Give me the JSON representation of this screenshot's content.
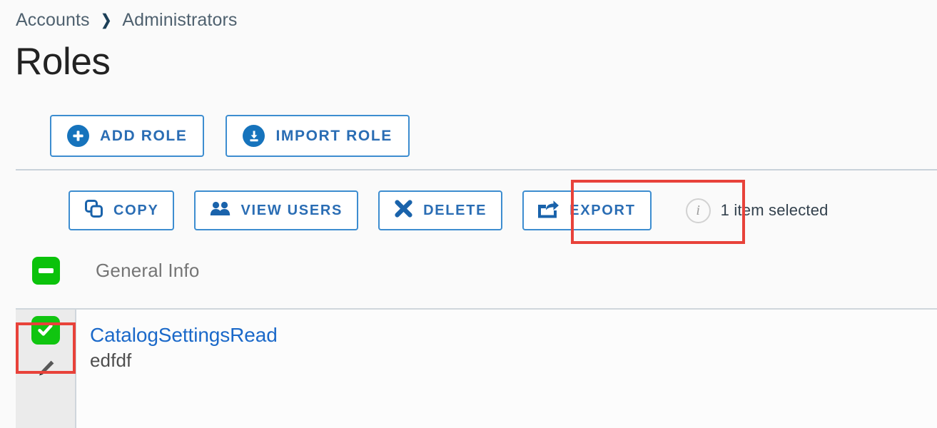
{
  "breadcrumb": {
    "items": [
      {
        "label": "Accounts"
      },
      {
        "label": "Administrators"
      }
    ],
    "separator": "❯"
  },
  "page": {
    "title": "Roles"
  },
  "actions": [
    {
      "label": "Add Role",
      "icon": "plus-circle-icon"
    },
    {
      "label": "Import Role",
      "icon": "import-circle-icon"
    }
  ],
  "toolbar": {
    "buttons": [
      {
        "label": "Copy",
        "icon": "copy-icon"
      },
      {
        "label": "View Users",
        "icon": "users-icon"
      },
      {
        "label": "Delete",
        "icon": "close-x-icon"
      },
      {
        "label": "Export",
        "icon": "export-icon"
      }
    ],
    "info_icon": "info-icon",
    "info_glyph": "i",
    "selection_status": "1 item selected"
  },
  "section": {
    "label": "General Info",
    "collapse_icon": "collapse-minus-icon",
    "expanded": true
  },
  "grid": {
    "rows": [
      {
        "selected": true,
        "checkbox_icon": "checkbox-checked-icon",
        "edit_icon": "pencil-icon",
        "name": "CatalogSettingsRead",
        "description": "edfdf"
      }
    ]
  },
  "annotations": [
    {
      "target": "export-button",
      "color": "#e8423a"
    },
    {
      "target": "row-checkbox",
      "color": "#e8423a"
    }
  ],
  "colors": {
    "accent_blue": "#2a6db4",
    "border_blue": "#3d8dd0",
    "icon_blue": "#1673bc",
    "link_blue": "#1b69c9",
    "green": "#10c510",
    "annotation_red": "#e8423a",
    "background": "#fafafa"
  }
}
